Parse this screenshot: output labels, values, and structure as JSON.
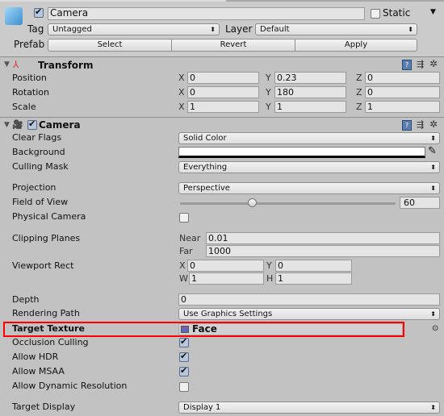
{
  "header": {
    "active": true,
    "name": "Camera",
    "static_label": "Static",
    "static": false,
    "tag_label": "Tag",
    "tag_value": "Untagged",
    "layer_label": "Layer",
    "layer_value": "Default",
    "prefab_label": "Prefab",
    "select": "Select",
    "revert": "Revert",
    "apply": "Apply"
  },
  "transform": {
    "title": "Transform",
    "position": {
      "label": "Position",
      "x": "0",
      "y": "0.23",
      "z": "0"
    },
    "rotation": {
      "label": "Rotation",
      "x": "0",
      "y": "180",
      "z": "0"
    },
    "scale": {
      "label": "Scale",
      "x": "1",
      "y": "1",
      "z": "1"
    }
  },
  "axes": {
    "x": "X",
    "y": "Y",
    "z": "Z",
    "w": "W",
    "h": "H"
  },
  "camera": {
    "title": "Camera",
    "enabled": true,
    "clear_flags": {
      "label": "Clear Flags",
      "value": "Solid Color"
    },
    "background": {
      "label": "Background",
      "color": "#ffffff"
    },
    "culling_mask": {
      "label": "Culling Mask",
      "value": "Everything"
    },
    "projection": {
      "label": "Projection",
      "value": "Perspective"
    },
    "fov": {
      "label": "Field of View",
      "value": "60",
      "min": 1,
      "max": 179
    },
    "physical": {
      "label": "Physical Camera",
      "checked": false
    },
    "clipping": {
      "label": "Clipping Planes",
      "near_label": "Near",
      "near": "0.01",
      "far_label": "Far",
      "far": "1000"
    },
    "viewport": {
      "label": "Viewport Rect",
      "x": "0",
      "y": "0",
      "w": "1",
      "h": "1"
    },
    "depth": {
      "label": "Depth",
      "value": "0"
    },
    "rendering_path": {
      "label": "Rendering Path",
      "value": "Use Graphics Settings"
    },
    "target_texture": {
      "label": "Target Texture",
      "value": "Face",
      "highlight_color": "#ff0000"
    },
    "occlusion": {
      "label": "Occlusion Culling",
      "checked": true
    },
    "hdr": {
      "label": "Allow HDR",
      "checked": true
    },
    "msaa": {
      "label": "Allow MSAA",
      "checked": true
    },
    "dynamic_res": {
      "label": "Allow Dynamic Resolution",
      "checked": false
    },
    "target_display": {
      "label": "Target Display",
      "value": "Display 1"
    }
  }
}
